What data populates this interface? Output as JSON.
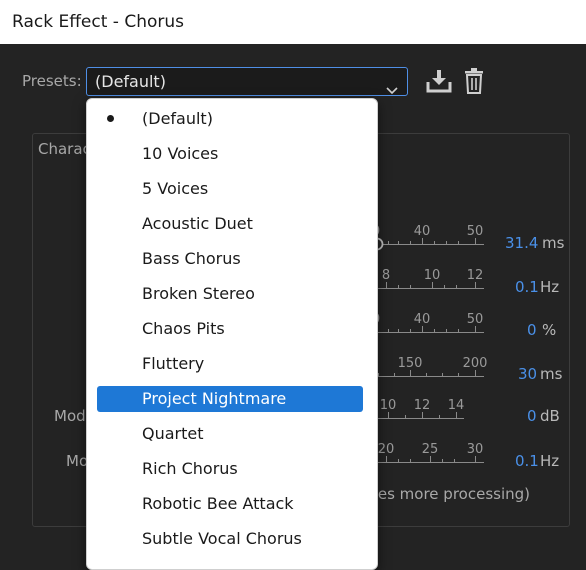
{
  "window": {
    "title": "Rack Effect - Chorus"
  },
  "presets": {
    "label": "Presets:",
    "selected": "(Default)",
    "options": [
      "(Default)",
      "10 Voices",
      "5 Voices",
      "Acoustic Duet",
      "Bass Chorus",
      "Broken Stereo",
      "Chaos Pits",
      "Fluttery",
      "Project Nightmare",
      "Quartet",
      "Rich Chorus",
      "Robotic Bee Attack",
      "Subtle Vocal Chorus"
    ],
    "current_index": 0,
    "highlighted_index": 8
  },
  "panel": {
    "title_partial": "Charac",
    "left_labels": [
      "Mod",
      "Mo"
    ],
    "hint_partial": "zes more processing)"
  },
  "sliders": [
    {
      "ticks": [
        "0",
        "40",
        "50"
      ],
      "value": "31.4",
      "unit": "ms"
    },
    {
      "ticks": [
        "8",
        "10",
        "12"
      ],
      "value": "0.1",
      "unit": "Hz"
    },
    {
      "ticks": [
        "0",
        "40",
        "50"
      ],
      "value": "0",
      "unit": "%"
    },
    {
      "ticks": [
        "150",
        "200"
      ],
      "value": "30",
      "unit": "ms"
    },
    {
      "ticks": [
        "10",
        "12",
        "14"
      ],
      "value": "0",
      "unit": "dB"
    },
    {
      "ticks": [
        "20",
        "25",
        "30"
      ],
      "value": "0.1",
      "unit": "Hz"
    }
  ],
  "icons": {
    "save": "download-icon",
    "delete": "trash-icon",
    "chevron": "chevron-down-icon"
  },
  "colors": {
    "accent": "#1e78d6",
    "value_blue": "#4a90e8",
    "background": "#232323"
  }
}
